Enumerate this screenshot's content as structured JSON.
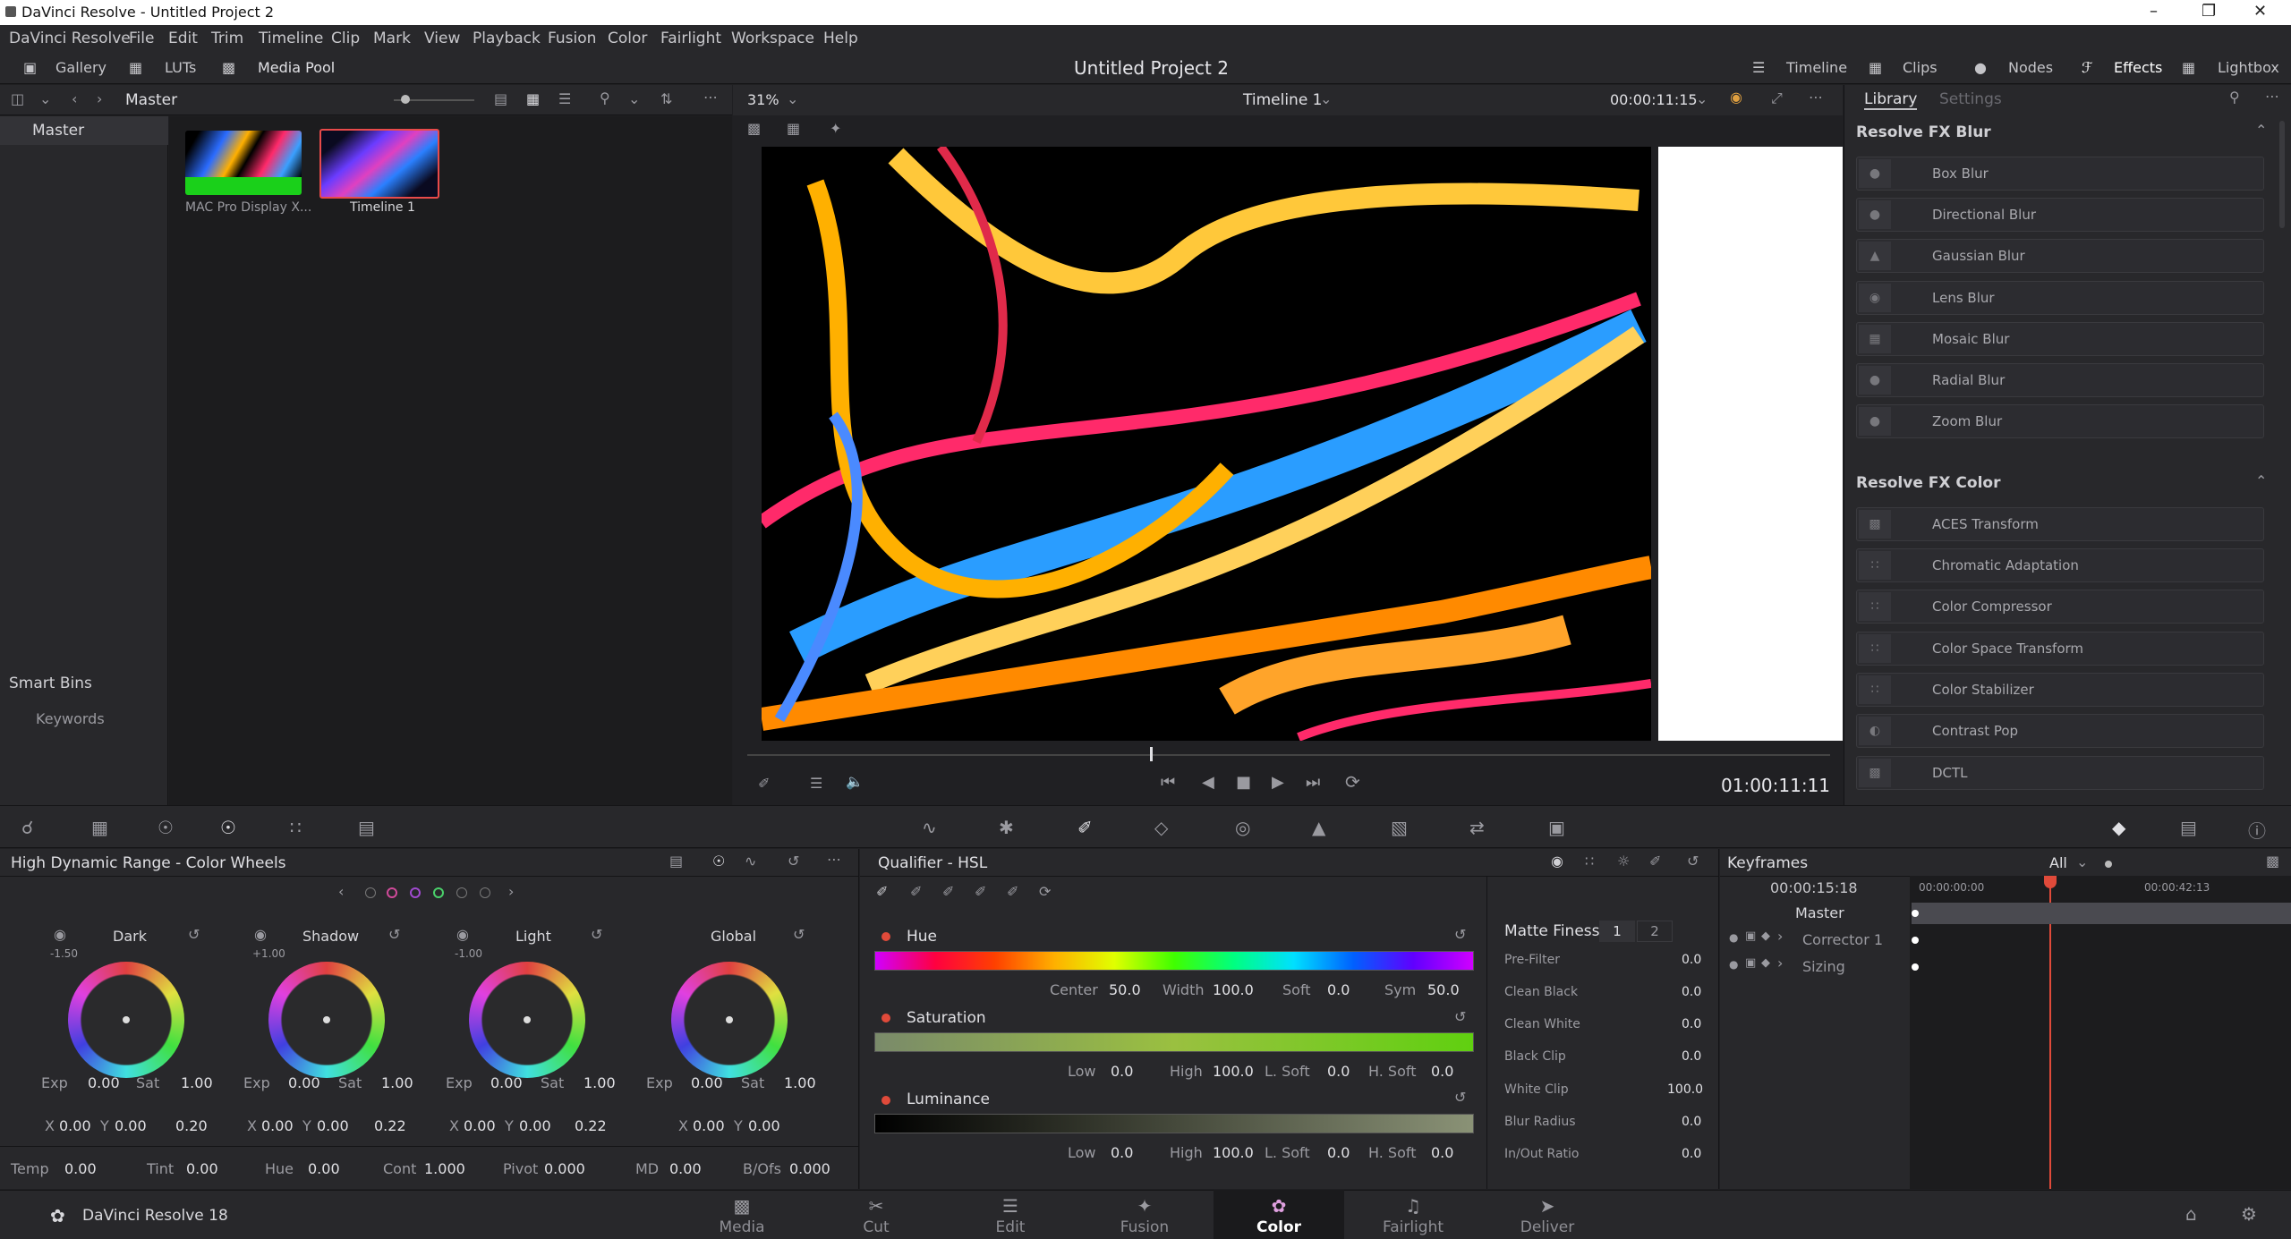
{
  "window": {
    "title": "DaVinci Resolve - Untitled Project 2"
  },
  "menu": [
    "DaVinci Resolve",
    "File",
    "Edit",
    "Trim",
    "Timeline",
    "Clip",
    "Mark",
    "View",
    "Playback",
    "Fusion",
    "Color",
    "Fairlight",
    "Workspace",
    "Help"
  ],
  "topbar": {
    "gallery": "Gallery",
    "luts": "LUTs",
    "media_pool": "Media Pool",
    "project": "Untitled Project 2",
    "timeline": "Timeline",
    "clips": "Clips",
    "nodes": "Nodes",
    "effects": "Effects",
    "lightbox": "Lightbox"
  },
  "mediapool": {
    "bin": "Master",
    "tree_master": "Master",
    "smart_bins": "Smart Bins",
    "keywords": "Keywords",
    "clips": [
      {
        "name": "MAC Pro Display X..."
      },
      {
        "name": "Timeline 1"
      }
    ]
  },
  "viewer": {
    "zoom": "31%",
    "timeline_name": "Timeline 1",
    "timecode_top": "00:00:11:15",
    "timecode": "01:00:11:11"
  },
  "library": {
    "tab_library": "Library",
    "tab_settings": "Settings",
    "blur_header": "Resolve FX Blur",
    "blur": [
      "Box Blur",
      "Directional Blur",
      "Gaussian Blur",
      "Lens Blur",
      "Mosaic Blur",
      "Radial Blur",
      "Zoom Blur"
    ],
    "color_header": "Resolve FX Color",
    "color": [
      "ACES Transform",
      "Chromatic Adaptation",
      "Color Compressor",
      "Color Space Transform",
      "Color Stabilizer",
      "Contrast Pop",
      "DCTL"
    ]
  },
  "wheels": {
    "title": "High Dynamic Range - Color Wheels",
    "items": [
      {
        "name": "Dark",
        "top": "-1.50",
        "exp": "0.00",
        "sat": "1.00",
        "x": "0.00",
        "y": "0.00",
        "z": "0.20"
      },
      {
        "name": "Shadow",
        "top": "+1.00",
        "exp": "0.00",
        "sat": "1.00",
        "x": "0.00",
        "y": "0.00",
        "z": "0.22"
      },
      {
        "name": "Light",
        "top": "-1.00",
        "exp": "0.00",
        "sat": "1.00",
        "x": "0.00",
        "y": "0.00",
        "z": "0.22"
      },
      {
        "name": "Global",
        "top": "",
        "exp": "0.00",
        "sat": "1.00",
        "x": "0.00",
        "y": "0.00",
        "z": ""
      }
    ],
    "labels": {
      "exp": "Exp",
      "sat": "Sat",
      "x": "X",
      "y": "Y"
    },
    "bottom": [
      {
        "label": "Temp",
        "value": "0.00"
      },
      {
        "label": "Tint",
        "value": "0.00"
      },
      {
        "label": "Hue",
        "value": "0.00"
      },
      {
        "label": "Cont",
        "value": "1.000"
      },
      {
        "label": "Pivot",
        "value": "0.000"
      },
      {
        "label": "MD",
        "value": "0.00"
      },
      {
        "label": "B/Ofs",
        "value": "0.000"
      }
    ]
  },
  "qualifier": {
    "title": "Qualifier - HSL",
    "hue": "Hue",
    "saturation": "Saturation",
    "luminance": "Luminance",
    "hue_vals": {
      "center_l": "Center",
      "center": "50.0",
      "width_l": "Width",
      "width": "100.0",
      "soft_l": "Soft",
      "soft": "0.0",
      "sym_l": "Sym",
      "sym": "50.0"
    },
    "sat_vals": {
      "low_l": "Low",
      "low": "0.0",
      "high_l": "High",
      "high": "100.0",
      "lsoft_l": "L. Soft",
      "lsoft": "0.0",
      "hsoft_l": "H. Soft",
      "hsoft": "0.0"
    },
    "lum_vals": {
      "low_l": "Low",
      "low": "0.0",
      "high_l": "High",
      "high": "100.0",
      "lsoft_l": "L. Soft",
      "lsoft": "0.0",
      "hsoft_l": "H. Soft",
      "hsoft": "0.0"
    }
  },
  "matte": {
    "title": "Matte Finesse",
    "tab1": "1",
    "tab2": "2",
    "rows": [
      {
        "label": "Pre-Filter",
        "value": "0.0"
      },
      {
        "label": "Clean Black",
        "value": "0.0"
      },
      {
        "label": "Clean White",
        "value": "0.0"
      },
      {
        "label": "Black Clip",
        "value": "0.0"
      },
      {
        "label": "White Clip",
        "value": "100.0"
      },
      {
        "label": "Blur Radius",
        "value": "0.0"
      },
      {
        "label": "In/Out Ratio",
        "value": "0.0"
      }
    ]
  },
  "keyframes": {
    "title": "Keyframes",
    "filter": "All",
    "timecode": "00:00:15:18",
    "t0": "00:00:00:00",
    "t1": "00:00:42:13",
    "rows": [
      "Master",
      "Corrector 1",
      "Sizing"
    ]
  },
  "footer": {
    "app": "DaVinci Resolve 18",
    "pages": [
      "Media",
      "Cut",
      "Edit",
      "Fusion",
      "Color",
      "Fairlight",
      "Deliver"
    ]
  }
}
